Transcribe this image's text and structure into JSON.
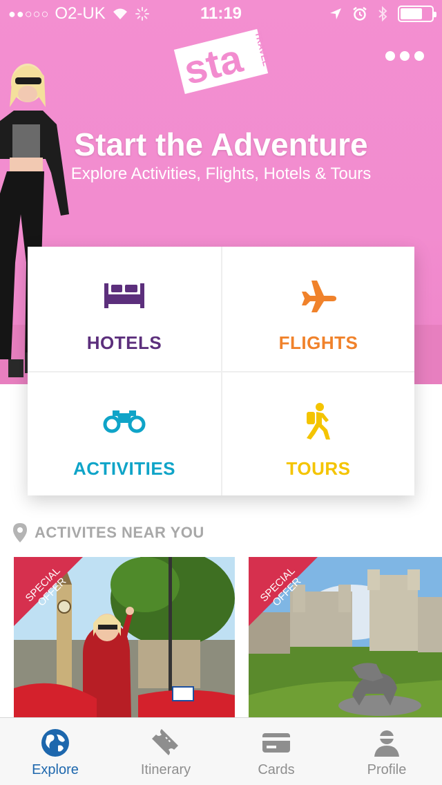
{
  "status_bar": {
    "signal": "●●○○○",
    "carrier": "O2-UK",
    "time": "11:19"
  },
  "header": {
    "logo_text": "sta",
    "logo_subtext": "TRAVEL",
    "title": "Start the Adventure",
    "subtitle": "Explore Activities, Flights, Hotels & Tours"
  },
  "categories": [
    {
      "label": "HOTELS",
      "icon": "bed-icon",
      "color": "#5c2f7c"
    },
    {
      "label": "FLIGHTS",
      "icon": "airplane-icon",
      "color": "#f0822b"
    },
    {
      "label": "ACTIVITIES",
      "icon": "binoculars-icon",
      "color": "#0fa4c8"
    },
    {
      "label": "TOURS",
      "icon": "hiker-icon",
      "color": "#f4c400"
    }
  ],
  "nearby": {
    "title": "ACTIVITES NEAR YOU",
    "tiles": [
      {
        "badge": "SPECIAL OFFER"
      },
      {
        "badge": "SPECIAL OFFER"
      }
    ]
  },
  "tabbar": {
    "tabs": [
      {
        "label": "Explore",
        "icon": "globe-icon",
        "active": true
      },
      {
        "label": "Itinerary",
        "icon": "ticket-icon",
        "active": false
      },
      {
        "label": "Cards",
        "icon": "card-icon",
        "active": false
      },
      {
        "label": "Profile",
        "icon": "user-icon",
        "active": false
      }
    ]
  },
  "colors": {
    "hero_pink": "#f28ccf",
    "ribbon": "#d6304e",
    "active_tab": "#1d67ad",
    "inactive_tab": "#8e8e8e"
  }
}
